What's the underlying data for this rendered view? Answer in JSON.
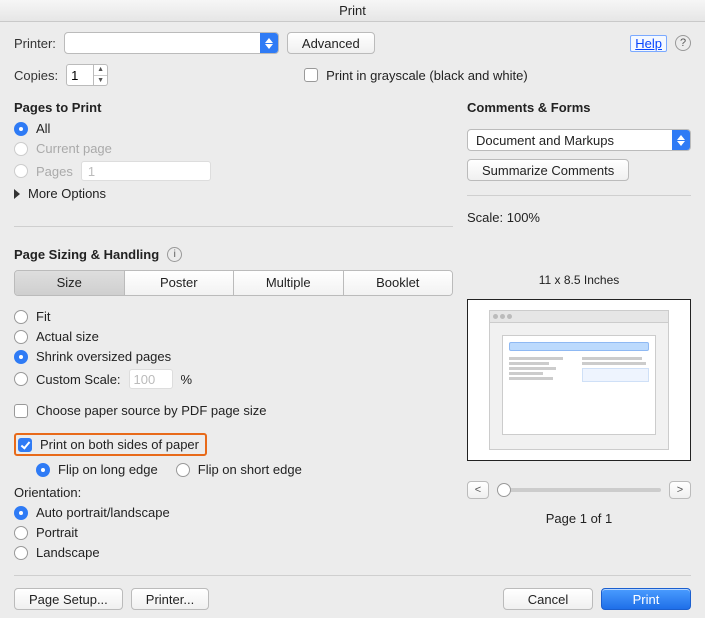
{
  "window": {
    "title": "Print"
  },
  "top": {
    "printer_label": "Printer:",
    "printer_value": "",
    "advanced": "Advanced",
    "help": "Help",
    "copies_label": "Copies:",
    "copies_value": "1",
    "grayscale_label": "Print in grayscale (black and white)"
  },
  "pages": {
    "heading": "Pages to Print",
    "all": "All",
    "current": "Current page",
    "pages_label": "Pages",
    "pages_value": "1",
    "more": "More Options"
  },
  "sizing": {
    "heading": "Page Sizing & Handling",
    "seg": {
      "size": "Size",
      "poster": "Poster",
      "multiple": "Multiple",
      "booklet": "Booklet"
    },
    "fit": "Fit",
    "actual": "Actual size",
    "shrink": "Shrink oversized pages",
    "custom": "Custom Scale:",
    "custom_value": "100",
    "custom_unit": "%",
    "choose_source": "Choose paper source by PDF page size"
  },
  "duplex": {
    "both_sides": "Print on both sides of paper",
    "flip_long": "Flip on long edge",
    "flip_short": "Flip on short edge"
  },
  "orientation": {
    "heading": "Orientation:",
    "auto": "Auto portrait/landscape",
    "portrait": "Portrait",
    "landscape": "Landscape"
  },
  "right": {
    "heading": "Comments & Forms",
    "select_value": "Document and Markups",
    "summarize": "Summarize Comments",
    "scale_label": "Scale: 100%",
    "dims": "11 x 8.5 Inches",
    "page_of": "Page 1 of 1"
  },
  "footer": {
    "page_setup": "Page Setup...",
    "printer_btn": "Printer...",
    "cancel": "Cancel",
    "print": "Print"
  }
}
